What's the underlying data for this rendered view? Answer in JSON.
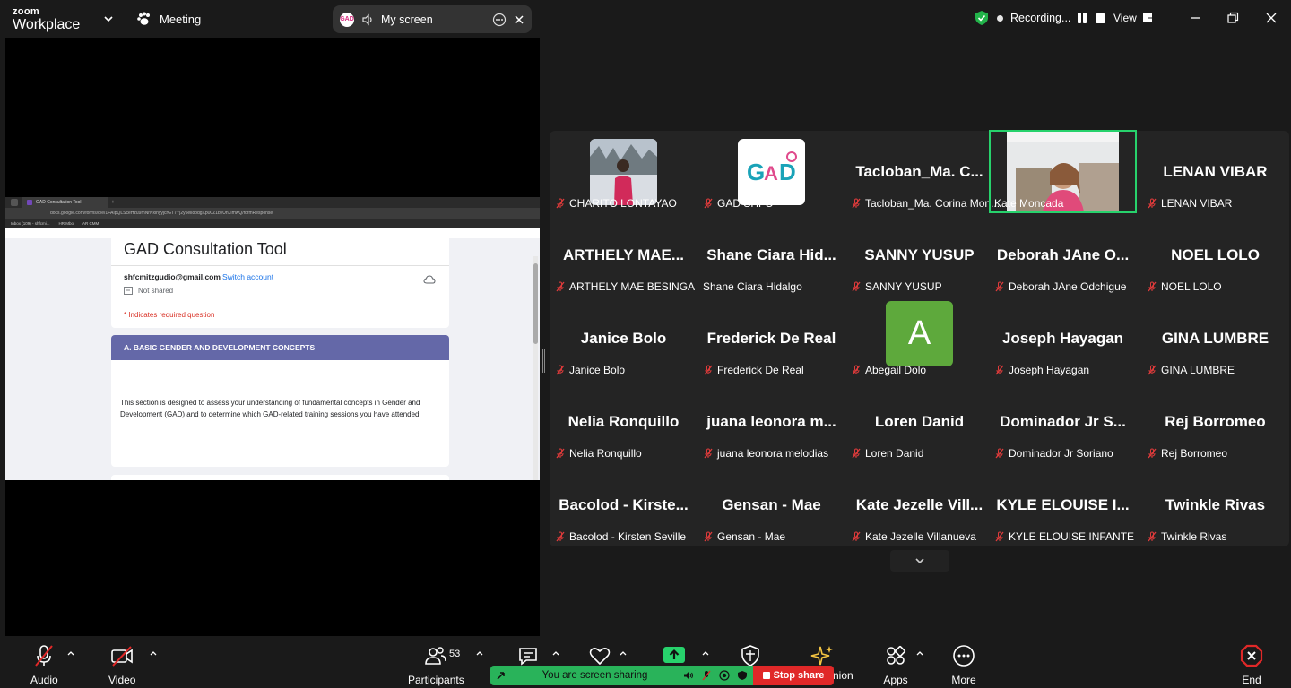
{
  "app": {
    "logo_line1": "zoom",
    "logo_line2": "Workplace",
    "meeting_label": "Meeting",
    "screen_label": "My screen",
    "gad_icon_text": "GAD",
    "recording_label": "Recording...",
    "view_label": "View"
  },
  "browser": {
    "tab_title": "GAD Consultation Tool",
    "url": "docs.google.com/forms/d/e/1FAIpQLSceHzu9mNrNxihyyjcrGT7Yj2y5eli8bdgXp00Z1byUnJImwQ/formResponse",
    "bookmarks": [
      "Inbox (109) - shfcmi...",
      "HR Mbo",
      "AR CMM"
    ]
  },
  "form": {
    "title": "GAD Consultation Tool",
    "email": "shfcmitzgudio@gmail.com",
    "switch_account": "Switch account",
    "not_shared": "Not shared",
    "required_note": "* Indicates required question",
    "section_title": "A. BASIC GENDER AND DEVELOPMENT CONCEPTS",
    "section_text": "This section is designed to assess your understanding of fundamental concepts in Gender and Development (GAD) and to determine which GAD-related training sessions you have attended."
  },
  "participants": [
    {
      "big": "",
      "label": "CHARITO LONTAYAO",
      "photo": "person"
    },
    {
      "big": "",
      "label": "GAD SHFC",
      "photo": "gad"
    },
    {
      "big": "Tacloban_Ma. C...",
      "label": "Tacloban_Ma. Corina Mon...",
      "photo": ""
    },
    {
      "big": "",
      "label": "Kate Moncada",
      "photo": "video",
      "active": true
    },
    {
      "big": "LENAN VIBAR",
      "label": "LENAN VIBAR",
      "photo": ""
    },
    {
      "big": "ARTHELY MAE...",
      "label": "ARTHELY MAE BESINGA",
      "photo": ""
    },
    {
      "big": "Shane Ciara Hid...",
      "label": "Shane Ciara Hidalgo",
      "photo": "",
      "nomute": true
    },
    {
      "big": "SANNY YUSUP",
      "label": "SANNY YUSUP",
      "photo": ""
    },
    {
      "big": "Deborah JAne O...",
      "label": "Deborah JAne Odchigue",
      "photo": ""
    },
    {
      "big": "NOEL LOLO",
      "label": "NOEL LOLO",
      "photo": ""
    },
    {
      "big": "Janice Bolo",
      "label": "Janice Bolo",
      "photo": ""
    },
    {
      "big": "Frederick De Real",
      "label": "Frederick De Real",
      "photo": ""
    },
    {
      "big": "",
      "label": "Abegail Dolo",
      "photo": "avatar",
      "avatar_letter": "A"
    },
    {
      "big": "Joseph Hayagan",
      "label": "Joseph Hayagan",
      "photo": ""
    },
    {
      "big": "GINA LUMBRE",
      "label": "GINA LUMBRE",
      "photo": ""
    },
    {
      "big": "Nelia Ronquillo",
      "label": "Nelia Ronquillo",
      "photo": ""
    },
    {
      "big": "juana leonora m...",
      "label": "juana leonora melodias",
      "photo": ""
    },
    {
      "big": "Loren Danid",
      "label": "Loren Danid",
      "photo": ""
    },
    {
      "big": "Dominador Jr S...",
      "label": "Dominador Jr Soriano",
      "photo": ""
    },
    {
      "big": "Rej Borromeo",
      "label": "Rej Borromeo",
      "photo": ""
    },
    {
      "big": "Bacolod - Kirste...",
      "label": "Bacolod - Kirsten Seville",
      "photo": ""
    },
    {
      "big": "Gensan - Mae",
      "label": "Gensan - Mae",
      "photo": ""
    },
    {
      "big": "Kate Jezelle Vill...",
      "label": "Kate Jezelle Villanueva",
      "photo": ""
    },
    {
      "big": "KYLE ELOUISE I...",
      "label": "KYLE ELOUISE INFANTE",
      "photo": ""
    },
    {
      "big": "Twinkle Rivas",
      "label": "Twinkle Rivas",
      "photo": ""
    }
  ],
  "toolbar": {
    "audio": "Audio",
    "video": "Video",
    "participants": "Participants",
    "participant_count": "53",
    "apps": "Apps",
    "more": "More",
    "end": "End",
    "companion_partial": "nion",
    "sharing_text": "You are screen sharing",
    "stop_share": "Stop share"
  },
  "colors": {
    "active_speaker": "#27d26c",
    "section_header": "#6468a8",
    "stop_share": "#e02828",
    "sharing_bar": "#29b35a",
    "avatar_bg": "#5ea93c"
  }
}
